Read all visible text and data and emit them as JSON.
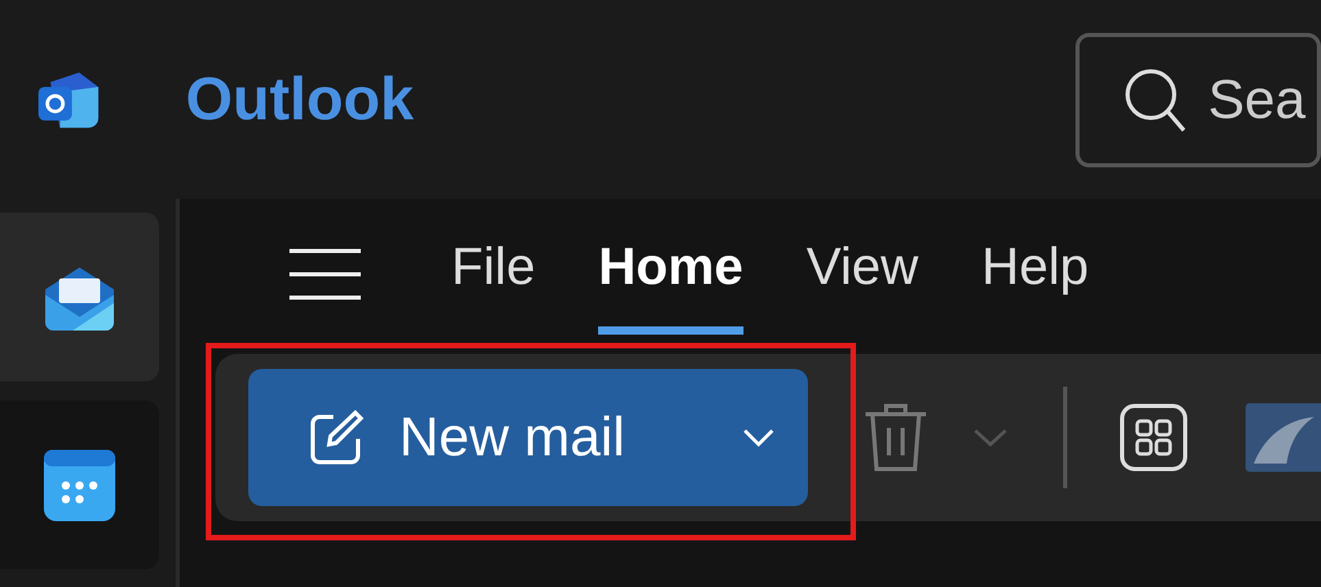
{
  "app": {
    "title": "Outlook"
  },
  "search": {
    "placeholder": "Sea"
  },
  "rail": [
    {
      "kind": "mail",
      "selected": true
    },
    {
      "kind": "calendar",
      "selected": false
    }
  ],
  "tabs": [
    {
      "label": "File",
      "selected": false
    },
    {
      "label": "Home",
      "selected": true
    },
    {
      "label": "View",
      "selected": false
    },
    {
      "label": "Help",
      "selected": false
    }
  ],
  "ribbon": {
    "new_mail": "New mail",
    "delete_disabled": true,
    "highlighted": true
  }
}
